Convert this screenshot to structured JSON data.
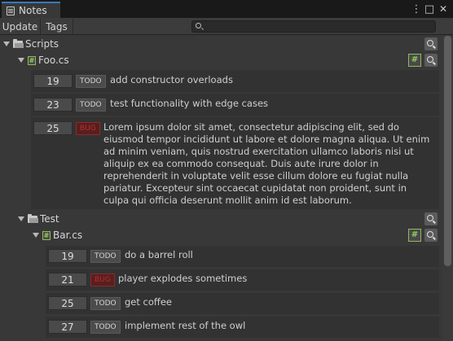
{
  "window": {
    "tab_title": "Notes",
    "tab_icon": "notes-window-icon",
    "menu_glyph": "⋮",
    "maximize_glyph": "□",
    "close_glyph": "✕"
  },
  "toolbar": {
    "update_label": "Update",
    "tags_label": "Tags",
    "search_value": "",
    "search_placeholder": ""
  },
  "tree": {
    "scripts_label": "Scripts",
    "foo_label": "Foo.cs",
    "test_label": "Test",
    "bar_label": "Bar.cs",
    "file_glyph": "#"
  },
  "notes": [
    {
      "line": "19",
      "tag": "TODO",
      "text": "add constructor overloads"
    },
    {
      "line": "23",
      "tag": "TODO",
      "text": "test functionality with edge cases"
    },
    {
      "line": "25",
      "tag": "BUG",
      "text": "Lorem ipsum dolor sit amet, consectetur adipiscing elit, sed do eiusmod tempor incididunt ut labore et dolore magna aliqua. Ut enim ad minim veniam, quis nostrud exercitation ullamco laboris nisi ut aliquip ex ea commodo consequat. Duis aute irure dolor in reprehenderit in voluptate velit esse cillum dolore eu fugiat nulla pariatur. Excepteur sint occaecat cupidatat non proident, sunt in culpa qui officia deserunt mollit anim id est laborum."
    },
    {
      "line": "19",
      "tag": "TODO",
      "text": "do a barrel roll"
    },
    {
      "line": "21",
      "tag": "BUG",
      "text": "player explodes sometimes"
    },
    {
      "line": "25",
      "tag": "TODO",
      "text": "get coffee"
    },
    {
      "line": "27",
      "tag": "TODO",
      "text": "implement rest of the owl"
    }
  ],
  "colors": {
    "background": "#383838",
    "accent": "#3a79bb",
    "bug": "#b03030",
    "script_icon": "#8fd25a"
  }
}
